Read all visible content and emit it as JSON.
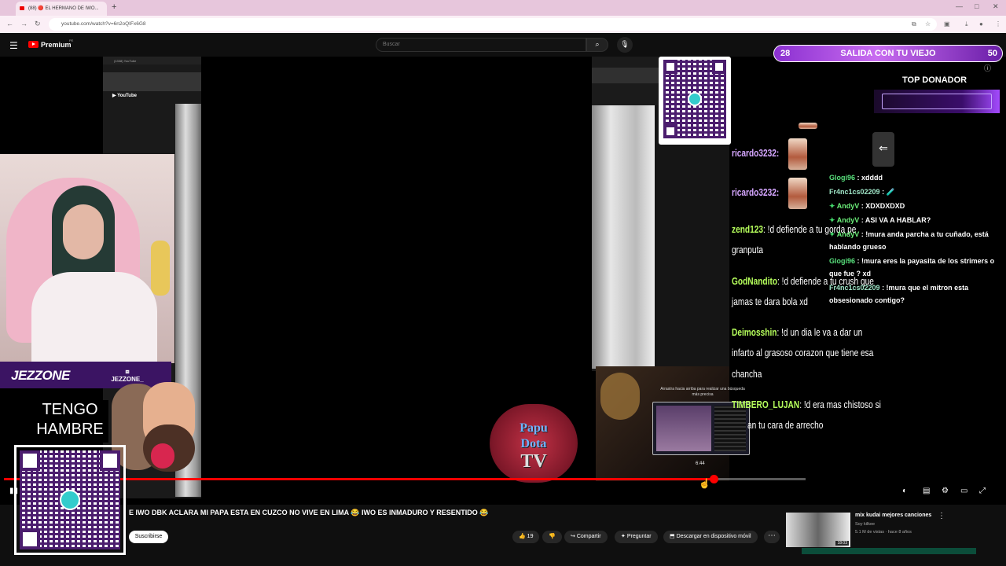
{
  "browser": {
    "tab_title": "(88) 🔴 EL HERMANO DE IWO...",
    "new_tab": "+",
    "url": "youtube.com/watch?v=6n2oQIFx6G8"
  },
  "yt": {
    "brand": "Premium",
    "brand_sup": "PE",
    "search_placeholder": "Buscar"
  },
  "overlay": {
    "brand_name": "JEZZONE",
    "twitch_handle": "JEZZONE_",
    "hungry_line1": "TENGO",
    "hungry_line2": "HAMBRE",
    "papu_line1": "Papu",
    "papu_line2": "Dota",
    "papu_line3": "TV",
    "goal_left": "28",
    "goal_label": "SALIDA CON TU VIEJO",
    "goal_right": "50",
    "top_donor": "TOP DONADOR",
    "preview_hint": "Arrastra hacia arriba para realizar una búsqueda más precisa",
    "preview_time": "6:44"
  },
  "chat_big": [
    {
      "user": "ricardo3232:",
      "text": ""
    },
    {
      "user": "ricardo3232:",
      "text": ""
    },
    {
      "user": "zend123",
      "text": ": !d defiende a tu gorda pe"
    },
    {
      "user": "",
      "text": "granputa"
    },
    {
      "user": "GodNandito",
      "text": ": !d defiende a tu crush que"
    },
    {
      "user": "",
      "text": "jamas te dara bola xd"
    },
    {
      "user": "Deimosshin",
      "text": ": !d un dia le va a dar un"
    },
    {
      "user": "",
      "text": "infarto al grasoso corazon que tiene esa"
    },
    {
      "user": "",
      "text": "chancha"
    },
    {
      "user": "TIMBERO_LUJAN",
      "text": ": !d era mas chistoso si"
    },
    {
      "user": "",
      "text": "an tu cara de arrecho"
    }
  ],
  "chat_small": [
    {
      "user": "Glogi96",
      "text": " : xdddd"
    },
    {
      "user": "Fr4nc1cs02209",
      "text": " : 🧪"
    },
    {
      "user": "AndyV",
      "text": " : XDXDXDXD"
    },
    {
      "user": "AndyV",
      "text": " : ASI VA A HABLAR?"
    },
    {
      "user": "AndyV",
      "text": " : !mura anda parcha a tu cuñado, está"
    },
    {
      "user": "",
      "text": "hablando grueso"
    },
    {
      "user": "Glogi96",
      "text": " : !mura eres la payasita de los strimers o"
    },
    {
      "user": "",
      "text": "que fue ? xd"
    },
    {
      "user": "Fr4nc1cs02209",
      "text": " : !mura que el mitron esta"
    },
    {
      "user": "",
      "text": "obsesionado contigo?"
    }
  ],
  "player": {
    "progress": 0.885
  },
  "below": {
    "video_title": "E IWO DBK ACLARA MI PAPA ESTA EN CUZCO NO VIVE EN LIMA 😂 IWO ES INMADURO Y RESENTIDO 😂",
    "subscribe": "Suscribirse",
    "likes": "19",
    "share": "Compartir",
    "ask": "Preguntar",
    "download": "Descargar en dispositivo móvil",
    "rec_title": "mix kudai mejores canciones",
    "rec_channel": "Soy kilkee",
    "rec_stats": "5.1 M de vistas · hace 8 años",
    "rec_duration": "18:03"
  }
}
